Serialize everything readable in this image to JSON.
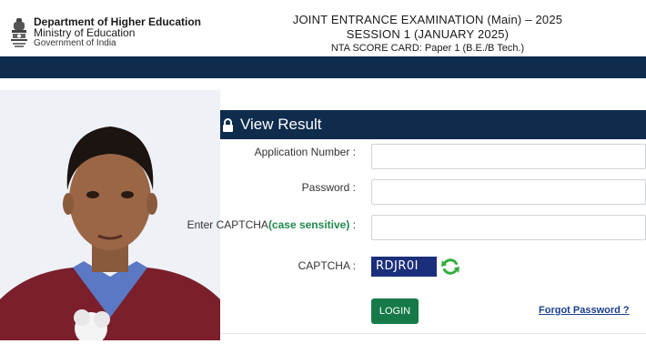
{
  "header": {
    "department": "Department of Higher Education",
    "ministry": "Ministry of Education",
    "government": "Government of India",
    "exam_title": "JOINT ENTRANCE EXAMINATION (Main) – 2025",
    "session": "SESSION 1 (JANUARY 2025)",
    "scorecard": "NTA SCORE CARD: Paper 1 (B.E./B Tech.)",
    "emblem_icon": "national-emblem-icon"
  },
  "panel": {
    "title": "View Result",
    "icon": "lock-icon"
  },
  "form": {
    "application_label": "Application Number :",
    "application_value": "",
    "password_label": "Password :",
    "password_value": "",
    "captcha_input_label_prefix": "Enter CAPTCHA",
    "captcha_input_label_case": "(case sensitive)",
    "captcha_input_label_suffix": " :",
    "captcha_input_value": "",
    "captcha_label": "CAPTCHA :",
    "captcha_text": "RDJR0I",
    "refresh_icon": "refresh-icon"
  },
  "actions": {
    "login_label": "LOGIN",
    "forgot_label": "Forgot Password ?"
  },
  "colors": {
    "navy": "#0f2c4d",
    "login_green": "#157a48",
    "captcha_bg": "#1b2e7a",
    "link_blue": "#1b3f8f",
    "case_green": "#1f8a4c"
  }
}
